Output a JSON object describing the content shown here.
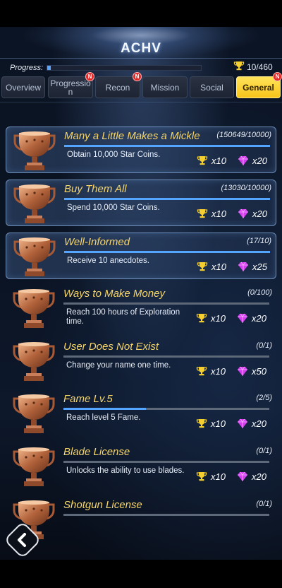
{
  "header": {
    "title": "ACHV"
  },
  "progress": {
    "label": "Progress:",
    "count": "10/460",
    "fraction": 0.022
  },
  "tabs": [
    {
      "label": "Overview",
      "badge": ""
    },
    {
      "label": "Progression",
      "badge": "N"
    },
    {
      "label": "Recon",
      "badge": "N"
    },
    {
      "label": "Mission",
      "badge": ""
    },
    {
      "label": "Social",
      "badge": ""
    },
    {
      "label": "General",
      "badge": "N"
    }
  ],
  "achievements": [
    {
      "name": "Many a Little Makes a Mickle",
      "count": "(150649/10000)",
      "desc": "Obtain 10,000 Star Coins.",
      "trophies": "x10",
      "gems": "x20",
      "fraction": 1.0
    },
    {
      "name": "Buy Them All",
      "count": "(13030/10000)",
      "desc": "Spend 10,000 Star Coins.",
      "trophies": "x10",
      "gems": "x20",
      "fraction": 1.0
    },
    {
      "name": "Well-Informed",
      "count": "(17/10)",
      "desc": "Receive 10 anecdotes.",
      "trophies": "x10",
      "gems": "x25",
      "fraction": 1.0
    },
    {
      "name": "Ways to Make Money",
      "count": "(0/100)",
      "desc": "Reach 100 hours of Exploration time.",
      "trophies": "x10",
      "gems": "x20",
      "fraction": 0.0
    },
    {
      "name": "User Does Not Exist",
      "count": "(0/1)",
      "desc": "Change your name one time.",
      "trophies": "x10",
      "gems": "x50",
      "fraction": 0.0
    },
    {
      "name": "Fame Lv.5",
      "count": "(2/5)",
      "desc": "Reach level 5 Fame.",
      "trophies": "x10",
      "gems": "x20",
      "fraction": 0.4
    },
    {
      "name": "Blade License",
      "count": "(0/1)",
      "desc": "Unlocks the ability to use blades.",
      "trophies": "x10",
      "gems": "x20",
      "fraction": 0.0
    },
    {
      "name": "Shotgun License",
      "count": "(0/1)",
      "desc": "",
      "trophies": "",
      "gems": "",
      "fraction": 0.0
    }
  ],
  "icons": {
    "trophy": "trophy-icon",
    "gem": "gem-icon",
    "back": "back-icon"
  },
  "colors": {
    "accent": "#f7c41a",
    "progress": "#54a5ff",
    "title_text": "#f6d56a",
    "gem": "#d63cf0",
    "badge": "#e12a2a"
  }
}
